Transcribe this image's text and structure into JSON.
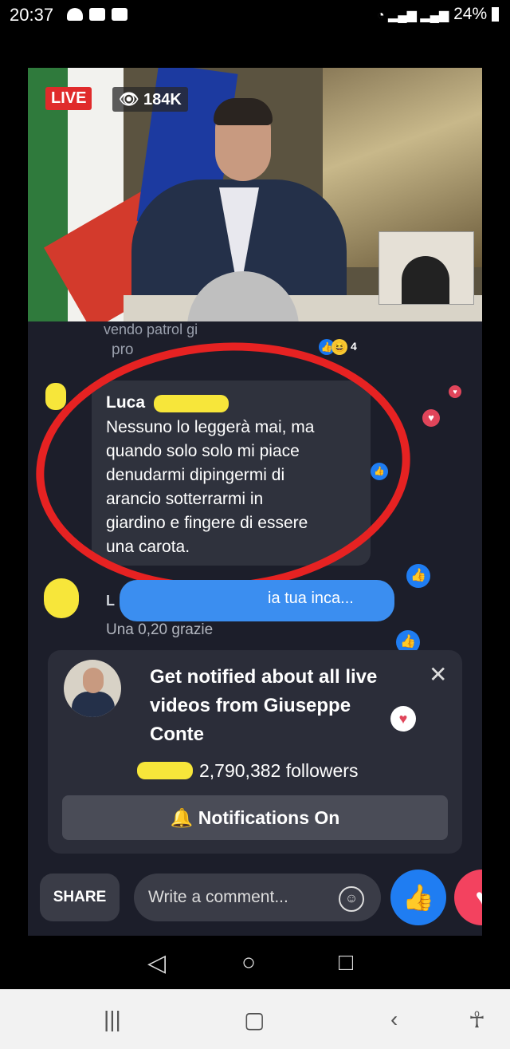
{
  "status_bar": {
    "time": "20:37",
    "battery": "24%"
  },
  "video": {
    "live_label": "LIVE",
    "viewer_count": "184K"
  },
  "faded_comment": {
    "text_top": "vendo patrol gi",
    "text_bottom": "pro",
    "reaction_count": "4"
  },
  "highlight_comment": {
    "author": "Luca",
    "lines": [
      "Nessuno lo leggerà mai, ma",
      "quando solo solo mi piace",
      "denudarmi dipingermi di",
      "arancio sotterrarmi in",
      "giardino e fingere di essere",
      "una carota."
    ]
  },
  "next_comment": {
    "initial": "L",
    "pill_text": "ia tua inca...",
    "text": "Una 0,20 grazie"
  },
  "notify_card": {
    "title": "Get notified about all live videos from Giuseppe Conte",
    "followers": "2,790,382 followers",
    "button": "Notifications On"
  },
  "bottom_bar": {
    "share": "SHARE",
    "comment_placeholder": "Write a comment..."
  },
  "colors": {
    "live_red": "#e02b2b",
    "fb_blue": "#1877f2",
    "annotation_red": "#e62222"
  }
}
